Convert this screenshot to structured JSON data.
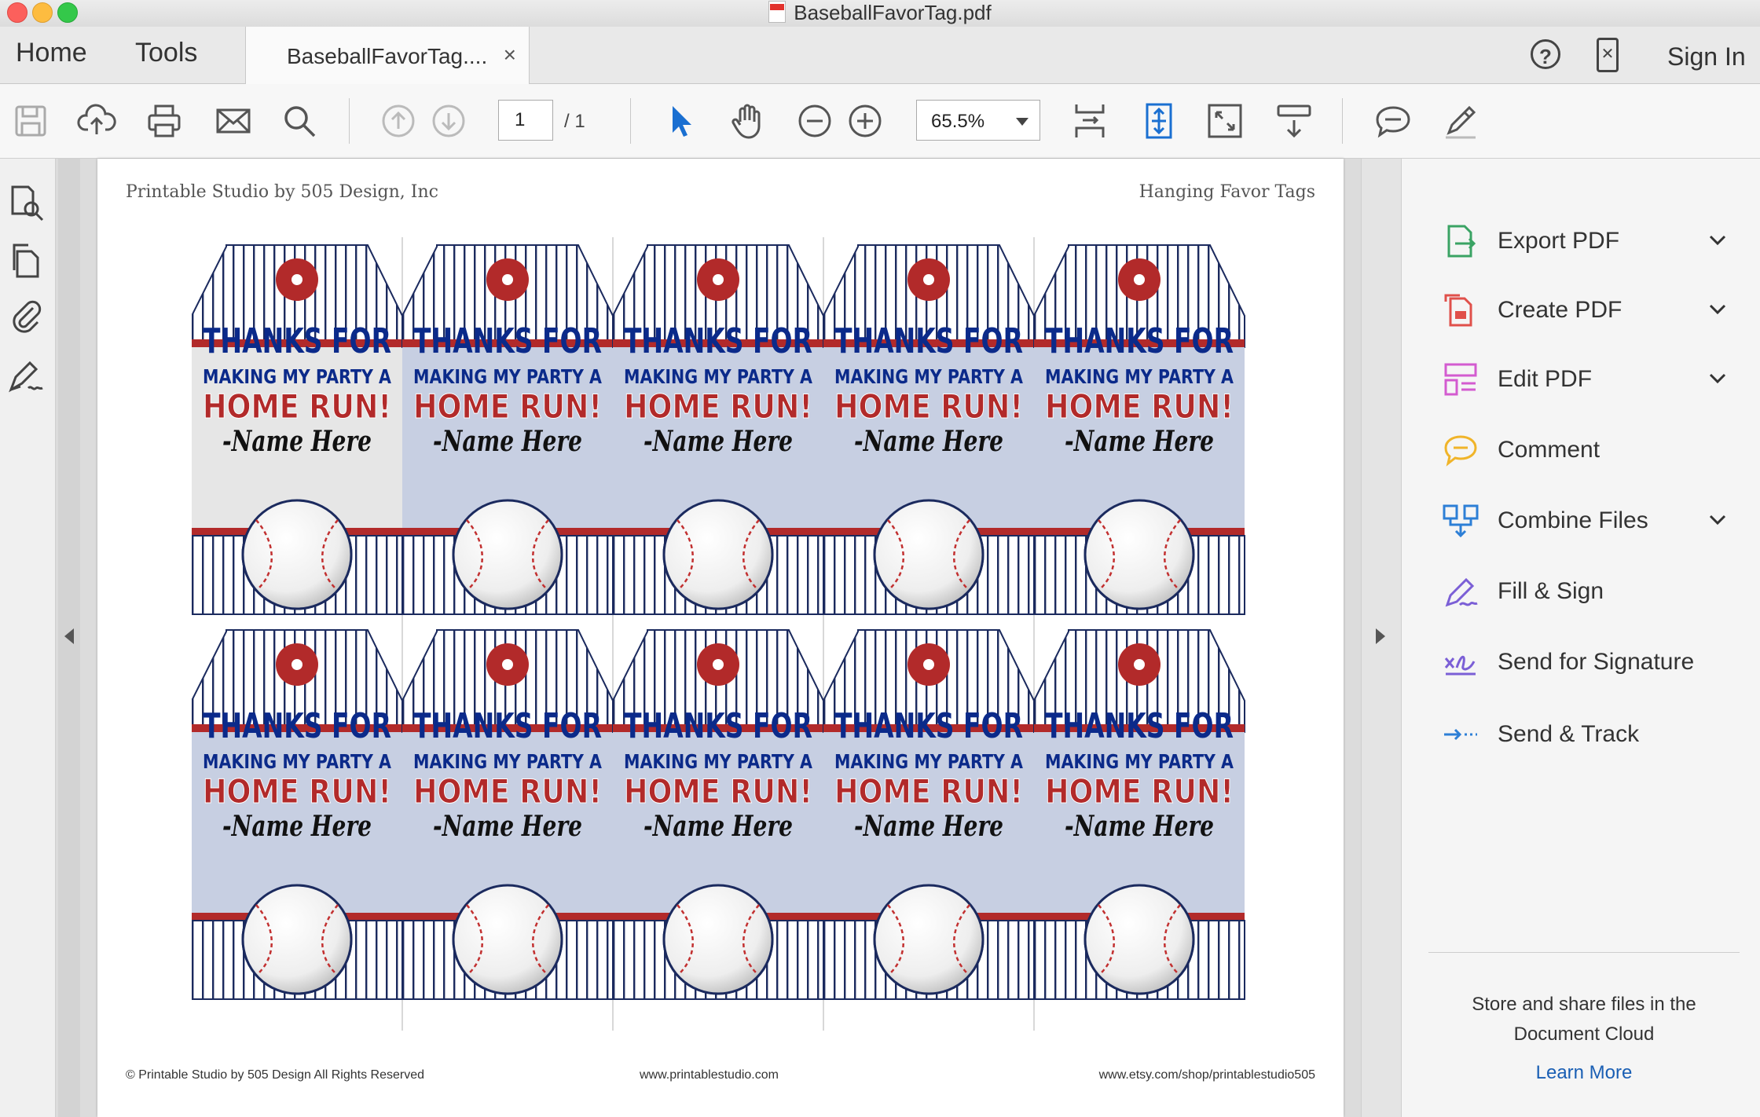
{
  "window": {
    "title": "BaseballFavorTag.pdf"
  },
  "tabs": {
    "home": "Home",
    "tools": "Tools",
    "document_tab": "BaseballFavorTag....",
    "close": "×",
    "help": "?",
    "signin": "Sign In"
  },
  "toolbar": {
    "page_current": "1",
    "page_total": "/ 1",
    "zoom": "65.5%"
  },
  "document": {
    "header_left": "Printable Studio by 505 Design, Inc",
    "header_right": "Hanging Favor Tags",
    "footer_left": "© Printable Studio by 505 Design All Rights Reserved",
    "footer_center": "www.printablestudio.com",
    "footer_right": "www.etsy.com/shop/printablestudio505",
    "tag": {
      "line1": "THANKS FOR",
      "line2": "MAKING MY PARTY A",
      "line3": "HOME RUN!",
      "line4": "-Name Here"
    },
    "colors": {
      "navy": "#0b2a8a",
      "red": "#b22a2a",
      "tint": "#dde6fb"
    }
  },
  "right_panel": {
    "tools": [
      {
        "label": "Export PDF",
        "icon": "export-pdf-icon",
        "chevron": true
      },
      {
        "label": "Create PDF",
        "icon": "create-pdf-icon",
        "chevron": true
      },
      {
        "label": "Edit PDF",
        "icon": "edit-pdf-icon",
        "chevron": true
      },
      {
        "label": "Comment",
        "icon": "comment-icon",
        "chevron": false
      },
      {
        "label": "Combine Files",
        "icon": "combine-files-icon",
        "chevron": true
      },
      {
        "label": "Fill & Sign",
        "icon": "fill-sign-icon",
        "chevron": false
      },
      {
        "label": "Send for Signature",
        "icon": "send-signature-icon",
        "chevron": false
      },
      {
        "label": "Send & Track",
        "icon": "send-track-icon",
        "chevron": false
      }
    ],
    "cloud_line1": "Store and share files in the",
    "cloud_line2": "Document Cloud",
    "learn_more": "Learn More"
  }
}
